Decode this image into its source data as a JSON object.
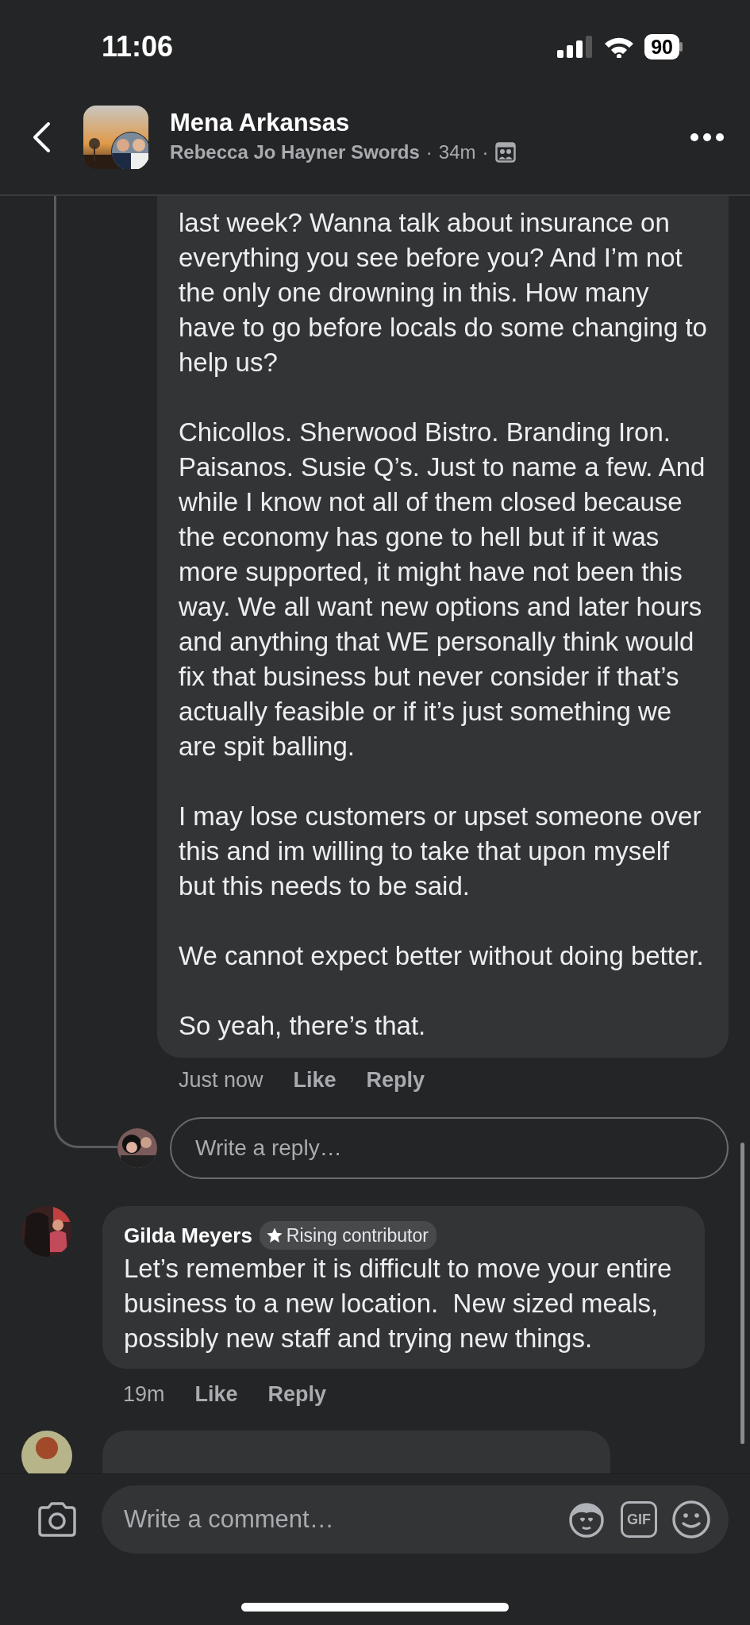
{
  "status_bar": {
    "time": "11:06",
    "battery": "90"
  },
  "header": {
    "title": "Mena Arkansas",
    "author": "Rebecca Jo Hayner Swords",
    "separator_1": "·",
    "time": "34m",
    "separator_2": "·"
  },
  "reply": {
    "paragraphs": [
      "last week? Wanna talk about insurance on everything you see before you? And I’m not the only one drowning in this. How many have to go before locals do some changing to help us?",
      "Chicollos. Sherwood Bistro. Branding Iron. Paisanos. Susie Q’s. Just to name a few. And while I know not all of them closed because the economy has gone to hell but if it was more supported, it might have not been this way. We all want new options and later hours and anything that WE personally think would fix that business but never consider if that’s actually feasible or if it’s just something we are spit balling.",
      "I may lose customers or upset someone over this and im willing to take that upon myself but this needs to be said.",
      "We cannot expect better without doing better.",
      "So yeah, there’s that."
    ],
    "time": "Just now",
    "actions": [
      "Like",
      "Reply"
    ]
  },
  "reply_field": {
    "placeholder": "Write a reply…"
  },
  "comments": [
    {
      "author": "Gilda Meyers",
      "badge": "Rising contributor",
      "text": "Let’s remember it is difficult to move your entire business to a new location.  New sized meals, possibly new staff and trying new things.",
      "time": "19m",
      "actions": [
        "Like",
        "Reply"
      ]
    }
  ],
  "comment_field": {
    "placeholder": "Write a comment…",
    "gif_label": "GIF"
  }
}
